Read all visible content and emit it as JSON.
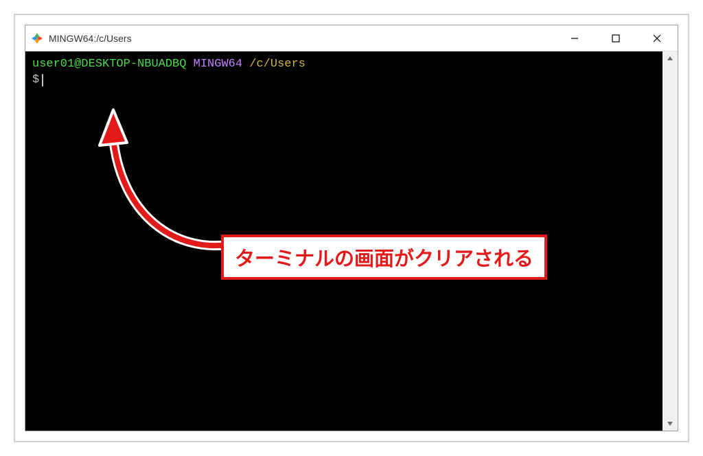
{
  "window": {
    "title": "MINGW64:/c/Users"
  },
  "prompt": {
    "user": "user01",
    "at": "@",
    "host": "DESKTOP-NBUADBQ",
    "sys": "MINGW64",
    "path": "/c/Users",
    "dollar": "$"
  },
  "annotation": {
    "text": "ターミナルの画面がクリアされる"
  }
}
